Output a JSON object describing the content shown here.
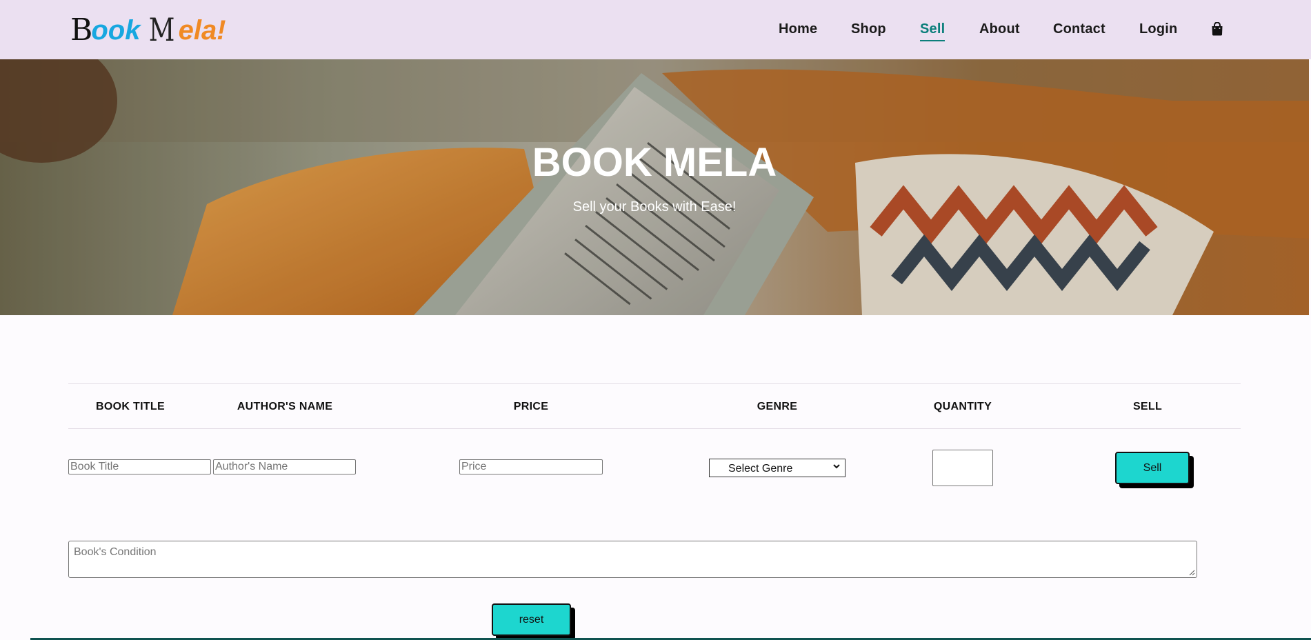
{
  "brand": {
    "logo_b": "B",
    "logo_ook": "ook",
    "logo_m": "M",
    "logo_ela": "ela!"
  },
  "nav": {
    "items": [
      {
        "label": "Home",
        "active": false
      },
      {
        "label": "Shop",
        "active": false
      },
      {
        "label": "Sell",
        "active": true
      },
      {
        "label": "About",
        "active": false
      },
      {
        "label": "Contact",
        "active": false
      },
      {
        "label": "Login",
        "active": false
      }
    ],
    "cart_icon": "shopping-bag-icon",
    "active_color": "#0b7f7b"
  },
  "hero": {
    "title": "BOOK MELA",
    "subtitle": "Sell your Books with Ease!"
  },
  "form": {
    "headers": [
      "BOOK TITLE",
      "AUTHOR'S NAME",
      "PRICE",
      "GENRE",
      "QUANTITY",
      "SELL"
    ],
    "book_title_placeholder": "Book Title",
    "author_placeholder": "Author's Name",
    "price_placeholder": "Price",
    "genre_selected": "Select Genre",
    "quantity_value": "",
    "sell_label": "Sell",
    "condition_placeholder": "Book's Condition",
    "reset_label": "reset",
    "button_color": "#1dd6cf"
  }
}
